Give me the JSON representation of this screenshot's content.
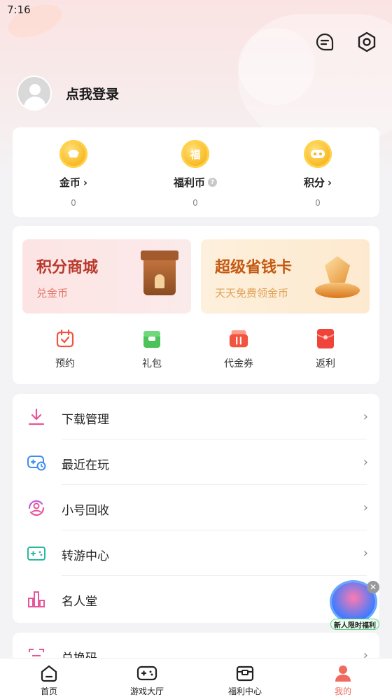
{
  "status": {
    "time": "7:16"
  },
  "header": {
    "login_text": "点我登录"
  },
  "wallet": {
    "items": [
      {
        "label": "金币",
        "value": "0",
        "icon_text": ""
      },
      {
        "label": "福利币",
        "value": "0",
        "icon_text": "福"
      },
      {
        "label": "积分",
        "value": "0",
        "icon_text": ""
      }
    ]
  },
  "banners": {
    "mall": {
      "title": "积分商城",
      "subtitle": "兑金币"
    },
    "card": {
      "title": "超级省钱卡",
      "subtitle": "天天免费领金币"
    }
  },
  "quick_actions": [
    {
      "label": "预约",
      "icon": "calendar-icon"
    },
    {
      "label": "礼包",
      "icon": "gift-icon"
    },
    {
      "label": "代金券",
      "icon": "voucher-icon"
    },
    {
      "label": "返利",
      "icon": "red-envelope-icon"
    }
  ],
  "menu": [
    {
      "label": "下载管理",
      "icon": "download-icon"
    },
    {
      "label": "最近在玩",
      "icon": "gamepad-clock-icon"
    },
    {
      "label": "小号回收",
      "icon": "account-recycle-icon"
    },
    {
      "label": "转游中心",
      "icon": "transfer-game-icon"
    },
    {
      "label": "名人堂",
      "icon": "hall-of-fame-icon"
    }
  ],
  "menu2": [
    {
      "label": "兑换码",
      "icon": "redeem-code-icon"
    }
  ],
  "float_badge": {
    "tag": "新人限时福利"
  },
  "tabs": [
    {
      "label": "首页",
      "icon": "home-icon"
    },
    {
      "label": "游戏大厅",
      "icon": "gamepad-icon"
    },
    {
      "label": "福利中心",
      "icon": "welfare-icon"
    },
    {
      "label": "我的",
      "icon": "profile-icon"
    }
  ],
  "colors": {
    "accent": "#f06a5f",
    "pink": "#e8559a",
    "teal": "#2bb8a0",
    "blue": "#3d8cf0"
  }
}
